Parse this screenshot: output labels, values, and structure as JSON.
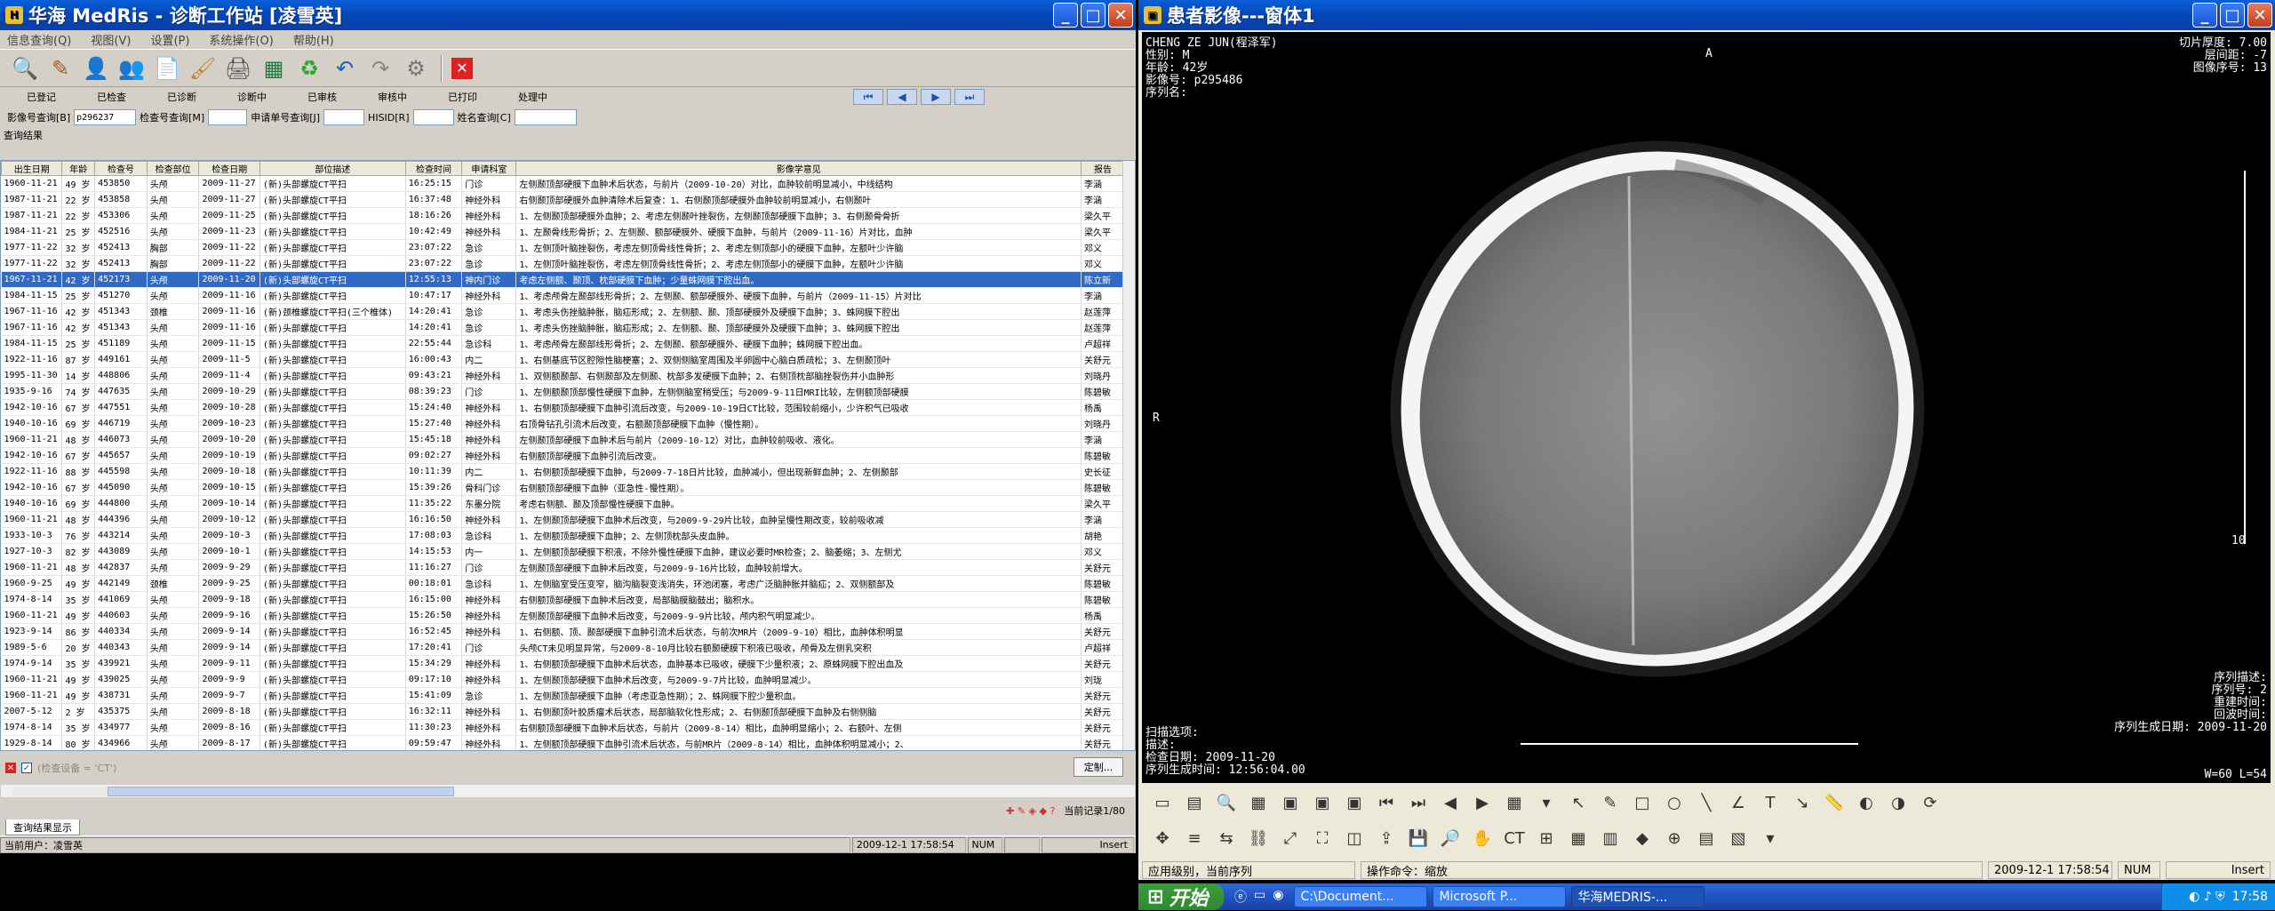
{
  "left": {
    "title": "华海 MedRis - 诊断工作站 [凌雪英]",
    "menu": [
      "信息查询(Q)",
      "视图(V)",
      "设置(P)",
      "系统操作(O)",
      "帮助(H)"
    ],
    "status_labels": [
      "已登记",
      "已检查",
      "已诊断",
      "诊断中",
      "已审核",
      "审核中",
      "已打印",
      "处理中"
    ],
    "query": {
      "image_no_label": "影像号查询[B]",
      "image_no_value": "p296237",
      "exam_no_label": "检查号查询[M]",
      "request_no_label": "申请单号查询[J]",
      "hisid_label": "HISID[R]",
      "name_label": "姓名查询[C]"
    },
    "result_label": "查询结果",
    "columns": [
      "出生日期",
      "年龄",
      "检查号",
      "检查部位",
      "检查日期",
      "部位描述",
      "检查时间",
      "申请科室",
      "影像学意见",
      "报告"
    ],
    "rows": [
      [
        "1960-11-21",
        "49 岁",
        "453850",
        "头颅",
        "2009-11-27",
        "(新)头部螺旋CT平扫",
        "16:25:15",
        "门诊",
        "左侧颞顶部硬膜下血肿术后状态，与前片（2009-10-20）对比，血肿较前明显减小，中线结构",
        "李涵"
      ],
      [
        "1987-11-21",
        "22 岁",
        "453858",
        "头颅",
        "2009-11-27",
        "(新)头部螺旋CT平扫",
        "16:37:48",
        "神经外科",
        "右侧颞顶部硬膜外血肿清除术后复查：1、右侧颞顶部硬膜外血肿较前明显减小，右侧颞叶",
        "李涵"
      ],
      [
        "1987-11-21",
        "22 岁",
        "453306",
        "头颅",
        "2009-11-25",
        "(新)头部螺旋CT平扫",
        "18:16:26",
        "神经外科",
        "1、左侧颞顶部硬膜外血肿；2、考虑左侧颞叶挫裂伤，左侧颞顶部硬膜下血肿；3、右侧颞骨骨折",
        "梁久平"
      ],
      [
        "1984-11-21",
        "25 岁",
        "452516",
        "头颅",
        "2009-11-23",
        "(新)头部螺旋CT平扫",
        "10:42:49",
        "神经外科",
        "1、左颞骨线形骨折；2、左侧颞、额部硬膜外、硬膜下血肿，与前片（2009-11-16）片对比，血肿",
        "梁久平"
      ],
      [
        "1977-11-22",
        "32 岁",
        "452413",
        "胸部",
        "2009-11-22",
        "(新)头部螺旋CT平扫",
        "23:07:22",
        "急诊",
        "1、左侧顶叶脑挫裂伤，考虑左侧顶骨线性骨折；2、考虑左侧顶部小的硬膜下血肿，左额叶少许脑",
        "邓义"
      ],
      [
        "1977-11-22",
        "32 岁",
        "452413",
        "胸部",
        "2009-11-22",
        "(新)头部螺旋CT平扫",
        "23:07:22",
        "急诊",
        "1、左侧顶叶脑挫裂伤，考虑左侧顶骨线性骨折；2、考虑左侧顶部小的硬膜下血肿，左额叶少许脑",
        "邓义"
      ],
      [
        "1967-11-21",
        "42 岁",
        "452173",
        "头颅",
        "2009-11-20",
        "(新)头部螺旋CT平扫",
        "12:55:13",
        "神内门诊",
        "考虑左侧额、颞顶、枕部硬膜下血肿；少量蛛网膜下腔出血。",
        "陈立新"
      ],
      [
        "1984-11-15",
        "25 岁",
        "451270",
        "头颅",
        "2009-11-16",
        "(新)头部螺旋CT平扫",
        "10:47:17",
        "神经外科",
        "1、考虑颅骨左颞部线形骨折；2、左侧颞、额部硬膜外、硬膜下血肿，与前片（2009-11-15）片对比",
        "李涵"
      ],
      [
        "1967-11-16",
        "42 岁",
        "451343",
        "颈椎",
        "2009-11-16",
        "(新)颈椎螺旋CT平扫(三个椎体)",
        "14:20:41",
        "急诊",
        "1、考虑头伤挫脑肿胀，脑疝形成；2、左侧额、颞、顶部硬膜外及硬膜下血肿；3、蛛网膜下腔出",
        "赵莲萍"
      ],
      [
        "1967-11-16",
        "42 岁",
        "451343",
        "头颅",
        "2009-11-16",
        "(新)头部螺旋CT平扫",
        "14:20:41",
        "急诊",
        "1、考虑头伤挫脑肿胀，脑疝形成；2、左侧额、颞、顶部硬膜外及硬膜下血肿；3、蛛网膜下腔出",
        "赵莲萍"
      ],
      [
        "1984-11-15",
        "25 岁",
        "451189",
        "头颅",
        "2009-11-15",
        "(新)头部螺旋CT平扫",
        "22:55:44",
        "急诊科",
        "1、考虑颅骨左颞部线形骨折；2、左侧颞、额部硬膜外、硬膜下血肿；蛛网膜下腔出血。",
        "卢超祥"
      ],
      [
        "1922-11-16",
        "87 岁",
        "449161",
        "头颅",
        "2009-11-5",
        "(新)头部螺旋CT平扫",
        "16:00:43",
        "内二",
        "1、右侧基底节区腔隙性脑梗塞；2、双侧侧脑室周围及半卵圆中心脑白质疏松；3、左侧颞顶叶",
        "关舒元"
      ],
      [
        "1995-11-30",
        "14 岁",
        "448806",
        "头颅",
        "2009-11-4",
        "(新)头部螺旋CT平扫",
        "09:43:21",
        "神经外科",
        "1、双侧额颞部、右侧颞部及左侧颞、枕部多发硬膜下血肿；2、右侧顶枕部脑挫裂伤并小血肿形",
        "刘晓丹"
      ],
      [
        "1935-9-16",
        "74 岁",
        "447635",
        "头颅",
        "2009-10-29",
        "(新)头部螺旋CT平扫",
        "08:39:23",
        "门诊",
        "1、左侧额颞顶部慢性硬膜下血肿，左侧侧脑室稍受压；与2009-9-11日MRI比较，左侧额顶部硬膜",
        "陈碧敏"
      ],
      [
        "1942-10-16",
        "67 岁",
        "447551",
        "头颅",
        "2009-10-28",
        "(新)头部螺旋CT平扫",
        "15:24:40",
        "神经外科",
        "1、右侧额顶部硬膜下血肿引流后改变，与2009-10-19日CT比较，范围较前缩小，少许积气已吸收",
        "杨禹"
      ],
      [
        "1940-10-16",
        "69 岁",
        "446719",
        "头颅",
        "2009-10-23",
        "(新)头部螺旋CT平扫",
        "15:27:40",
        "神经外科",
        "右顶骨钻孔引流术后改变，右额颞顶部硬膜下血肿（慢性期）。",
        "刘晓丹"
      ],
      [
        "1960-11-21",
        "48 岁",
        "446073",
        "头颅",
        "2009-10-20",
        "(新)头部螺旋CT平扫",
        "15:45:18",
        "神经外科",
        "左侧颞顶部硬膜下血肿术后与前片（2009-10-12）对比，血肿较前吸收、液化。",
        "李涵"
      ],
      [
        "1942-10-16",
        "67 岁",
        "445657",
        "头颅",
        "2009-10-19",
        "(新)头部螺旋CT平扫",
        "09:02:27",
        "神经外科",
        "右侧额顶部硬膜下血肿引流后改变。",
        "陈碧敏"
      ],
      [
        "1922-11-16",
        "88 岁",
        "445598",
        "头颅",
        "2009-10-18",
        "(新)头部螺旋CT平扫",
        "10:11:39",
        "内二",
        "1、右侧额顶部硬膜下血肿，与2009-7-18日片比较，血肿减小，但出现新鲜血肿；2、左侧颞部",
        "史长征"
      ],
      [
        "1942-10-16",
        "67 岁",
        "445090",
        "头颅",
        "2009-10-15",
        "(新)头部螺旋CT平扫",
        "15:39:26",
        "骨科门诊",
        "右侧额顶部硬膜下血肿（亚急性-慢性期）。",
        "陈碧敏"
      ],
      [
        "1940-10-16",
        "69 岁",
        "444800",
        "头颅",
        "2009-10-14",
        "(新)头部螺旋CT平扫",
        "11:35:22",
        "东墨分院",
        "考虑右侧额、颞及顶部慢性硬膜下血肿。",
        "梁久平"
      ],
      [
        "1960-11-21",
        "48 岁",
        "444396",
        "头颅",
        "2009-10-12",
        "(新)头部螺旋CT平扫",
        "16:16:50",
        "神经外科",
        "1、左侧颞顶部硬膜下血肿术后改变，与2009-9-29片比较，血肿呈慢性期改变，较前吸收减",
        "李涵"
      ],
      [
        "1933-10-3",
        "76 岁",
        "443214",
        "头颅",
        "2009-10-3",
        "(新)头部螺旋CT平扫",
        "17:08:03",
        "急诊科",
        "1、左侧额顶部硬膜下血肿；2、左侧顶枕部头皮血肿。",
        "胡艳"
      ],
      [
        "1927-10-3",
        "82 岁",
        "443089",
        "头颅",
        "2009-10-1",
        "(新)头部螺旋CT平扫",
        "14:15:53",
        "内一",
        "1、左侧额顶部硬膜下积液，不除外慢性硬膜下血肿，建议必要时MR检查；2、脑萎缩；3、左侧尤",
        "邓义"
      ],
      [
        "1960-11-21",
        "48 岁",
        "442837",
        "头颅",
        "2009-9-29",
        "(新)头部螺旋CT平扫",
        "11:16:27",
        "门诊",
        "左侧颞顶部硬膜下血肿术后改变，与2009-9-16片比较，血肿较前增大。",
        "关舒元"
      ],
      [
        "1960-9-25",
        "49 岁",
        "442149",
        "颈椎",
        "2009-9-25",
        "(新)头部螺旋CT平扫",
        "00:18:01",
        "急诊科",
        "1、左侧脑室受压变窄，脑沟脑裂变浅消失，环池闭塞，考虑广泛脑肿胀并脑疝；2、双侧额部及",
        "陈碧敏"
      ],
      [
        "1974-8-14",
        "35 岁",
        "441069",
        "头颅",
        "2009-9-18",
        "(新)头部螺旋CT平扫",
        "16:15:00",
        "神经外科",
        "右侧额顶部硬膜下血肿术后改变，局部脑膜脑鼓出；脑积水。",
        "陈碧敏"
      ],
      [
        "1960-11-21",
        "49 岁",
        "440603",
        "头颅",
        "2009-9-16",
        "(新)头部螺旋CT平扫",
        "15:26:50",
        "神经外科",
        "左侧颞顶部硬膜下血肿术后改变，与2009-9-9片比较，颅内积气明显减少。",
        "杨禹"
      ],
      [
        "1923-9-14",
        "86 岁",
        "440334",
        "头颅",
        "2009-9-14",
        "(新)头部螺旋CT平扫",
        "16:52:45",
        "神经外科",
        "1、右侧额、顶、颞部硬膜下血肿引流术后状态，与前次MR片（2009-9-10）相比，血肿体积明显",
        "关舒元"
      ],
      [
        "1989-5-6",
        "20 岁",
        "440343",
        "头颅",
        "2009-9-14",
        "(新)头部螺旋CT平扫",
        "17:20:41",
        "门诊",
        "头颅CT未见明显异常，与2009-8-10月比较右额颞硬膜下积液已吸收，颅骨及左侧乳突积",
        "卢超祥"
      ],
      [
        "1974-9-14",
        "35 岁",
        "439921",
        "头颅",
        "2009-9-11",
        "(新)头部螺旋CT平扫",
        "15:34:29",
        "神经外科",
        "1、右侧额顶部硬膜下血肿术后状态，血肿基本已吸收，硬膜下少量积液；2、原蛛网膜下腔出血及",
        "关舒元"
      ],
      [
        "1960-11-21",
        "49 岁",
        "439025",
        "头颅",
        "2009-9-9",
        "(新)头部螺旋CT平扫",
        "09:17:10",
        "神经外科",
        "1、左侧颞顶部硬膜下血肿术后改变，与2009-9-7片比较，血肿明显减少。",
        "刘珑"
      ],
      [
        "1960-11-21",
        "49 岁",
        "438731",
        "头颅",
        "2009-9-7",
        "(新)头部螺旋CT平扫",
        "15:41:09",
        "急诊",
        "1、左侧颞顶部硬膜下血肿（考虑亚急性期）；2、蛛网膜下腔少量积血。",
        "关舒元"
      ],
      [
        "2007-5-12",
        "2 岁",
        "435375",
        "头颅",
        "2009-8-18",
        "(新)头部螺旋CT平扫",
        "16:32:11",
        "神经外科",
        "1、右侧颞顶叶胶质瘤术后状态，局部脑软化性形成；2、右侧颞顶部硬膜下血肿及右侧侧脑",
        "关舒元"
      ],
      [
        "1974-8-14",
        "35 岁",
        "434977",
        "头颅",
        "2009-8-16",
        "(新)头部螺旋CT平扫",
        "11:30:23",
        "神经外科",
        "右侧额顶部硬膜下血肿术后状态，与前片（2009-8-14）相比，血肿明显缩小；2、右额叶、左侧",
        "关舒元"
      ],
      [
        "1929-8-14",
        "80 岁",
        "434966",
        "头颅",
        "2009-8-17",
        "(新)头部螺旋CT平扫",
        "09:59:47",
        "神经外科",
        "1、左侧额顶部硬膜下血肿引流术后状态，与前MR片（2009-8-14）相比，血肿体积明显减小；2、",
        "关舒元"
      ]
    ],
    "selected_row": 6,
    "filter_text": "(检查设备 = 'CT')",
    "custom_button": "定制...",
    "current_record": "当前记录1/80",
    "tab_label": "查询结果显示",
    "status": {
      "user": "当前用户：凌雪英",
      "datetime": "2009-12-1 17:58:54",
      "num": "NUM",
      "insert": "Insert"
    }
  },
  "right": {
    "title": "患者影像---窗体1",
    "patient": {
      "name": "CHENG ZE JUN(程泽军)",
      "sex": "性别: M",
      "age": "年龄: 42岁",
      "image_no": "影像号: p295486",
      "series": "序列名:"
    },
    "top_right": [
      "切片厚度: 7.00",
      "层间距: -7",
      "图像序号: 13"
    ],
    "orient_top": "A",
    "orient_left": "R",
    "ruler_label": "10",
    "bottom_left": {
      "scan_opt": "扫描选项:",
      "desc": "描述:",
      "exam_date": "检查日期: 2009-11-20",
      "series_time": "序列生成时间: 12:56:04.00"
    },
    "bottom_right": {
      "series_desc": "序列描述:",
      "series_no": "序列号: 2",
      "recon_time": "重建时间:",
      "acq_time": "回波时间:",
      "series_date": "序列生成日期: 2009-11-20"
    },
    "window_level": "W=60 L=54",
    "status": {
      "level": "应用级别，当前序列",
      "operation": "操作命令：缩放",
      "datetime": "2009-12-1 17:58:54",
      "num": "NUM",
      "insert": "Insert"
    }
  },
  "taskbar": {
    "start": "开始",
    "tasks": [
      "C:\\Document...",
      "Microsoft P...",
      "华海MEDRIS-..."
    ],
    "clock": "17:58"
  }
}
